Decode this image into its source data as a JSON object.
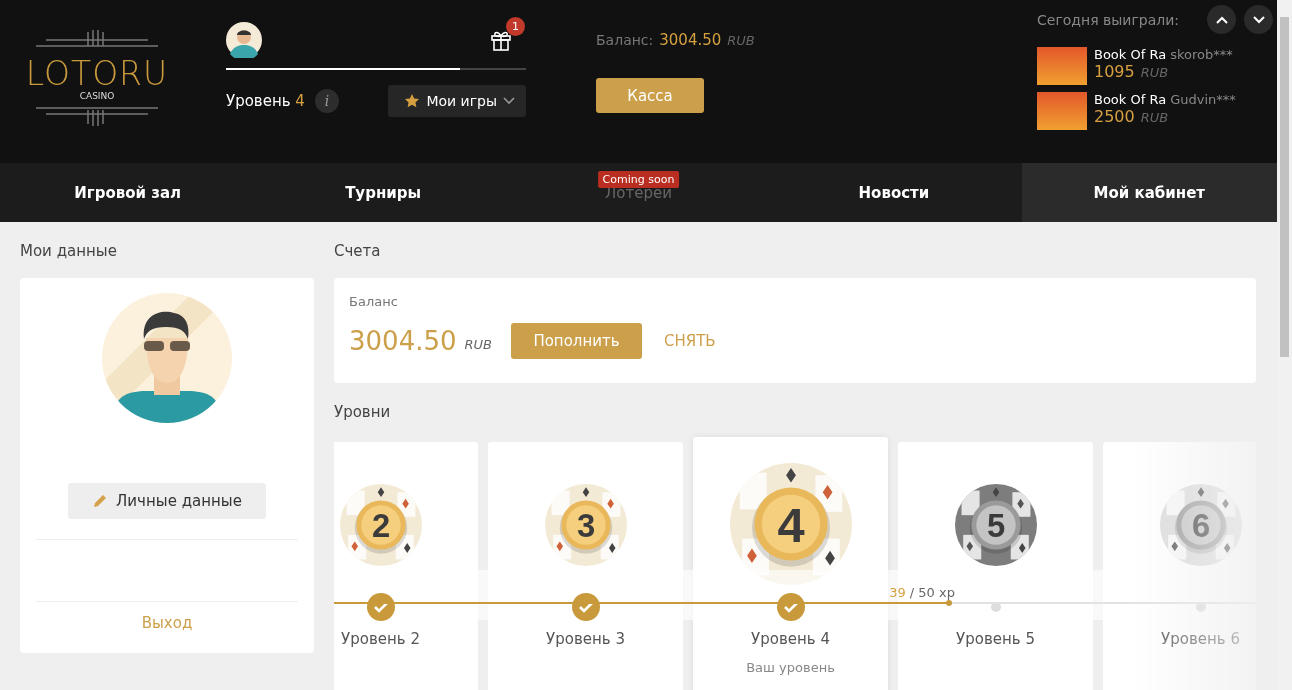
{
  "header": {
    "logo": {
      "name": "LOTORU",
      "tagline": "CASINO"
    },
    "user": {
      "progress": {
        "level": 0.78
      },
      "level_label": "Уровень",
      "level_value": "4",
      "info": "i",
      "gift_badge": "1",
      "my_games": "Мои игры"
    },
    "balance": {
      "label": "Баланс:",
      "amount": "3004.50",
      "currency": "RUB",
      "cashier_button": "Касса"
    },
    "winners": {
      "title": "Сегодня выиграли:",
      "items": [
        {
          "game": "Book Of Ra",
          "user": "skorob***",
          "amount": "1095",
          "currency": "RUB"
        },
        {
          "game": "Book Of Ra",
          "user": "Gudvin***",
          "amount": "2500",
          "currency": "RUB"
        }
      ]
    }
  },
  "nav": {
    "tabs": [
      {
        "label": "Игровой зал",
        "selected": false,
        "disabled": false
      },
      {
        "label": "Турниры",
        "selected": false,
        "disabled": false
      },
      {
        "label": "Лотереи",
        "selected": false,
        "disabled": true,
        "badge": "Coming soon"
      },
      {
        "label": "Новости",
        "selected": false,
        "disabled": false
      },
      {
        "label": "Мой кабинет",
        "selected": true,
        "disabled": false
      }
    ]
  },
  "profile": {
    "title": "Мои данные",
    "edit_button": "Личные данные",
    "logout": "Выход"
  },
  "accounts": {
    "title": "Счета",
    "balance_label": "Баланс",
    "amount": "3004.50",
    "currency": "RUB",
    "deposit_button": "Пополнить",
    "withdraw_link": "СНЯТЬ"
  },
  "levels": {
    "title": "Уровни",
    "progress": {
      "current": "39",
      "total": " / 50 xp",
      "level": 0.667
    },
    "items": [
      {
        "number": "2",
        "label": "Уровень 2",
        "completed": true,
        "current": false,
        "unlocked": true
      },
      {
        "number": "3",
        "label": "Уровень 3",
        "completed": true,
        "current": false,
        "unlocked": true
      },
      {
        "number": "4",
        "label": "Уровень 4",
        "completed": true,
        "current": true,
        "unlocked": true,
        "note": "Ваш уровень"
      },
      {
        "number": "5",
        "label": "Уровень 5",
        "completed": false,
        "current": false,
        "unlocked": false
      },
      {
        "number": "6",
        "label": "Уровень 6",
        "completed": false,
        "current": false,
        "unlocked": false
      }
    ]
  }
}
